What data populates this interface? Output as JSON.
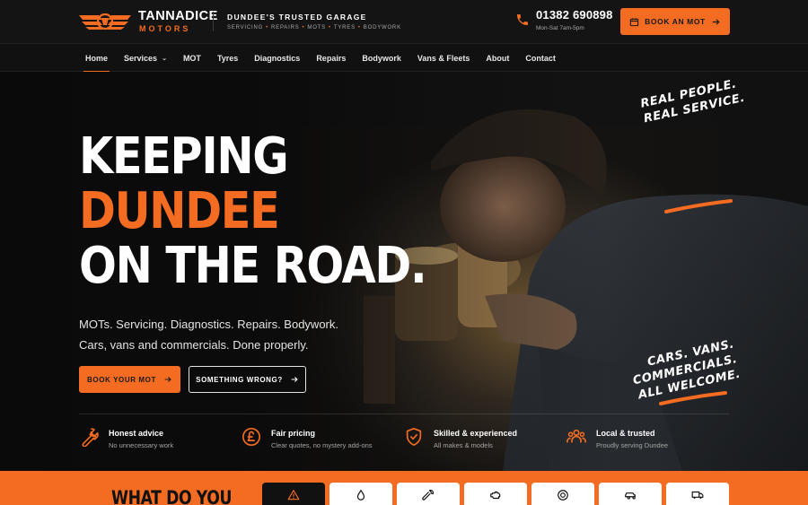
{
  "header": {
    "logo_top": "TANNADICE",
    "logo_bottom": "MOTORS",
    "tagline": "DUNDEE'S TRUSTED GARAGE",
    "services_line": [
      "SERVICING",
      "REPAIRS",
      "MOTS",
      "TYRES",
      "BODYWORK"
    ],
    "phone": "01382 690898",
    "hours": "Mon-Sat 7am-5pm",
    "cta_label": "BOOK AN MOT",
    "cta_icon": "calendar-icon",
    "accent": "#f36c21"
  },
  "nav": {
    "items": [
      "Home",
      "Services",
      "MOT",
      "Tyres",
      "Diagnostics",
      "Repairs",
      "Bodywork",
      "Vans & Fleets",
      "About",
      "Contact"
    ],
    "active": "Home"
  },
  "hero": {
    "line1": "KEEPING",
    "line2": "DUNDEE",
    "line3": "ON THE ROAD.",
    "sub1": "MOTs. Servicing. Diagnostics. Repairs. Bodywork.",
    "sub2": "Cars, vans and commercials. Done properly.",
    "btn_primary": "BOOK YOUR MOT",
    "btn_secondary": "SOMETHING WRONG?",
    "script_top": [
      "REAL PEOPLE.",
      "REAL SERVICE."
    ],
    "script_bottom": [
      "CARS. VANS.",
      "COMMERCIALS.",
      "ALL WELCOME."
    ]
  },
  "features": [
    {
      "title": "Honest advice",
      "sub": "No unnecessary work",
      "icon": "wrench-icon"
    },
    {
      "title": "Fair pricing",
      "sub": "Clear quotes, no mystery add-ons",
      "icon": "pound-icon"
    },
    {
      "title": "Skilled & experienced",
      "sub": "All makes & models",
      "icon": "shield-check-icon"
    },
    {
      "title": "Local & trusted",
      "sub": "Proudly serving Dundee",
      "icon": "people-icon"
    }
  ],
  "services_band": {
    "heading": "WHAT DO YOU",
    "tiles": [
      "warning-icon",
      "oil-drop-icon",
      "wrench-icon",
      "engine-icon",
      "tyre-icon",
      "car-icon",
      "van-icon"
    ]
  }
}
